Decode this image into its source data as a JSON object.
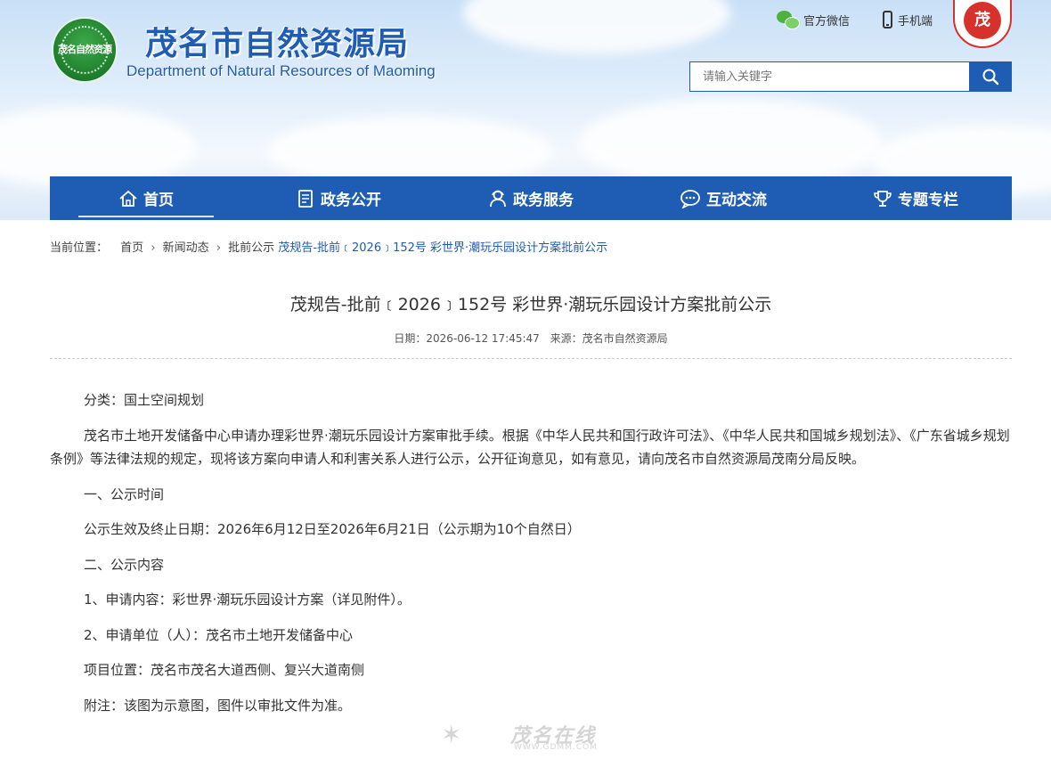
{
  "header": {
    "logo_text": "茂名自然资源",
    "title": "茂名市自然资源局",
    "subtitle": "Department of Natural Resources of Maoming",
    "links": {
      "wechat": "官方微信",
      "mobile": "手机端"
    },
    "badge_text": "茂",
    "search": {
      "placeholder": "请输入关键字"
    }
  },
  "nav": {
    "items": [
      {
        "label": "首页",
        "icon": "home-icon"
      },
      {
        "label": "政务公开",
        "icon": "document-icon"
      },
      {
        "label": "政务服务",
        "icon": "service-person-icon"
      },
      {
        "label": "互动交流",
        "icon": "chat-icon"
      },
      {
        "label": "专题专栏",
        "icon": "trophy-icon"
      }
    ]
  },
  "breadcrumb": {
    "label": "当前位置：",
    "items": [
      "首页",
      "新闻动态",
      "批前公示"
    ],
    "current": "茂规告-批前﹝2026﹞152号 彩世界·潮玩乐园设计方案批前公示"
  },
  "article": {
    "title": "茂规告-批前﹝2026﹞152号 彩世界·潮玩乐园设计方案批前公示",
    "date": "日期：2026-06-12 17:45:47",
    "source": "来源：茂名市自然资源局",
    "paragraphs": [
      "分类：国土空间规划",
      "茂名市土地开发储备中心申请办理彩世界·潮玩乐园设计方案审批手续。根据《中华人民共和国行政许可法》、《中华人民共和国城乡规划法》、《广东省城乡规划条例》等法律法规的规定，现将该方案向申请人和利害关系人进行公示，公开征询意见，如有意见，请向茂名市自然资源局茂南分局反映。",
      "一、公示时间",
      "公示生效及终止日期：2026年6月12日至2026年6月21日（公示期为10个自然日）",
      "二、公示内容",
      "1、申请内容：彩世界·潮玩乐园设计方案（详见附件）。",
      "2、申请单位（人）：茂名市土地开发储备中心",
      "项目位置：茂名市茂名大道西侧、复兴大道南侧",
      "附注：该图为示意图，图件以审批文件为准。"
    ]
  },
  "watermark": {
    "brand": "茂名在线",
    "url": "WWW.GDMM.COM"
  }
}
